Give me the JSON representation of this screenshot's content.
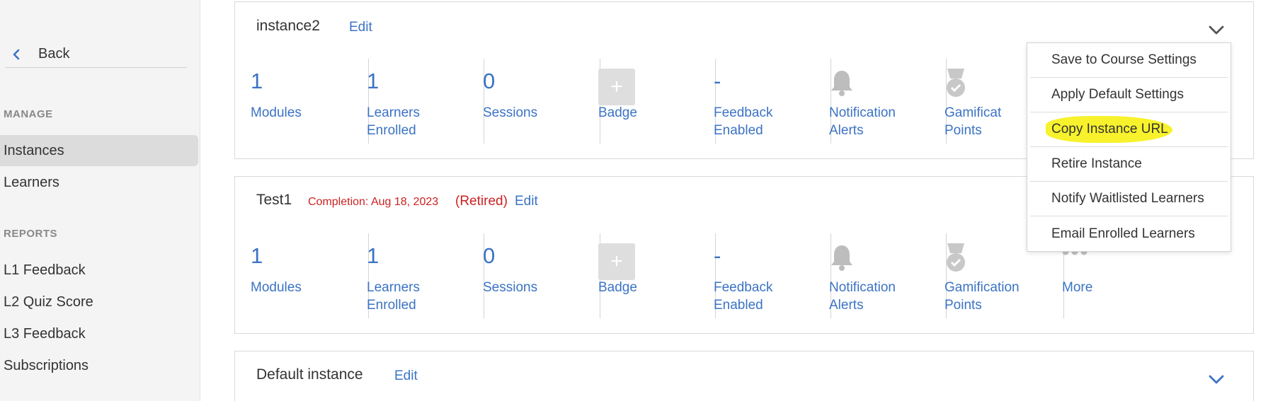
{
  "sidebar": {
    "back_label": "Back",
    "sections": [
      {
        "title": "MANAGE",
        "items": [
          {
            "label": "Instances",
            "active": true
          },
          {
            "label": "Learners",
            "active": false
          }
        ]
      },
      {
        "title": "REPORTS",
        "items": [
          {
            "label": "L1 Feedback"
          },
          {
            "label": "L2 Quiz Score"
          },
          {
            "label": "L3 Feedback"
          },
          {
            "label": "Subscriptions"
          }
        ]
      }
    ]
  },
  "instances": [
    {
      "name": "instance2",
      "edit_label": "Edit",
      "stats": {
        "modules": {
          "value": "1",
          "label1": "Modules",
          "label2": ""
        },
        "learners": {
          "value": "1",
          "label1": "Learners",
          "label2": "Enrolled"
        },
        "sessions": {
          "value": "0",
          "label1": "Sessions",
          "label2": ""
        },
        "badge": {
          "label1": "Badge"
        },
        "feedback": {
          "value": "-",
          "label1": "Feedback",
          "label2": "Enabled"
        },
        "notification": {
          "label1": "Notification",
          "label2": "Alerts"
        },
        "gamification": {
          "label1": "Gamificat",
          "label2": "Points"
        }
      }
    },
    {
      "name": "Test1",
      "completion": "Completion: Aug 18, 2023",
      "retired": "(Retired)",
      "edit_label": "Edit",
      "stats": {
        "modules": {
          "value": "1",
          "label1": "Modules"
        },
        "learners": {
          "value": "1",
          "label1": "Learners",
          "label2": "Enrolled"
        },
        "sessions": {
          "value": "0",
          "label1": "Sessions"
        },
        "badge": {
          "label1": "Badge"
        },
        "feedback": {
          "value": "-",
          "label1": "Feedback",
          "label2": "Enabled"
        },
        "notification": {
          "label1": "Notification",
          "label2": "Alerts"
        },
        "gamification": {
          "label1": "Gamification",
          "label2": "Points"
        },
        "more": {
          "label1": "More"
        }
      }
    },
    {
      "name": "Default instance",
      "edit_label": "Edit"
    }
  ],
  "menu": {
    "items": [
      "Save to Course Settings",
      "Apply Default Settings",
      "Copy Instance URL",
      "Retire Instance",
      "Notify Waitlisted Learners",
      "Email Enrolled Learners"
    ],
    "highlighted_index": 2
  },
  "colors": {
    "link": "#3b73c4",
    "retired": "#cc2222",
    "highlight": "#f7f22b"
  }
}
